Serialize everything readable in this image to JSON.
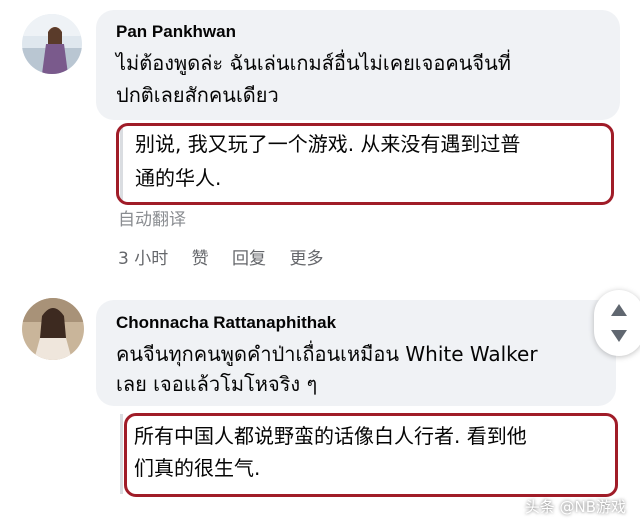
{
  "comments": [
    {
      "author": "Pan Pankhwan",
      "text_line1": "ไม่ต้องพูดล่ะ ฉันเล่นเกมส์อื่นไม่เคยเจอคนจีนที่",
      "text_line2": "ปกติเลยสักคนเดียว",
      "translation_line1": "别说, 我又玩了一个游戏. 从来没有遇到过普",
      "translation_line2": "通的华人.",
      "auto_translate_label": "自动翻译",
      "time": "3 小时",
      "like_label": "赞",
      "reply_label": "回复",
      "more_label": "更多"
    },
    {
      "author": "Chonnacha Rattanaphithak",
      "text_line1": "คนจีนทุกคนพูดคำป่าเถื่อนเหมือน White Walker",
      "text_line2": "เลย เจอแล้วโมโหจริง ๆ",
      "translation_line1": "所有中国人都说野蛮的话像白人行者. 看到他",
      "translation_line2": "们真的很生气."
    }
  ],
  "watermark": "头条 @NB游戏",
  "colors": {
    "highlight_border": "#a01c28",
    "bubble_bg": "#f0f2f5",
    "secondary_text": "#65676b"
  }
}
